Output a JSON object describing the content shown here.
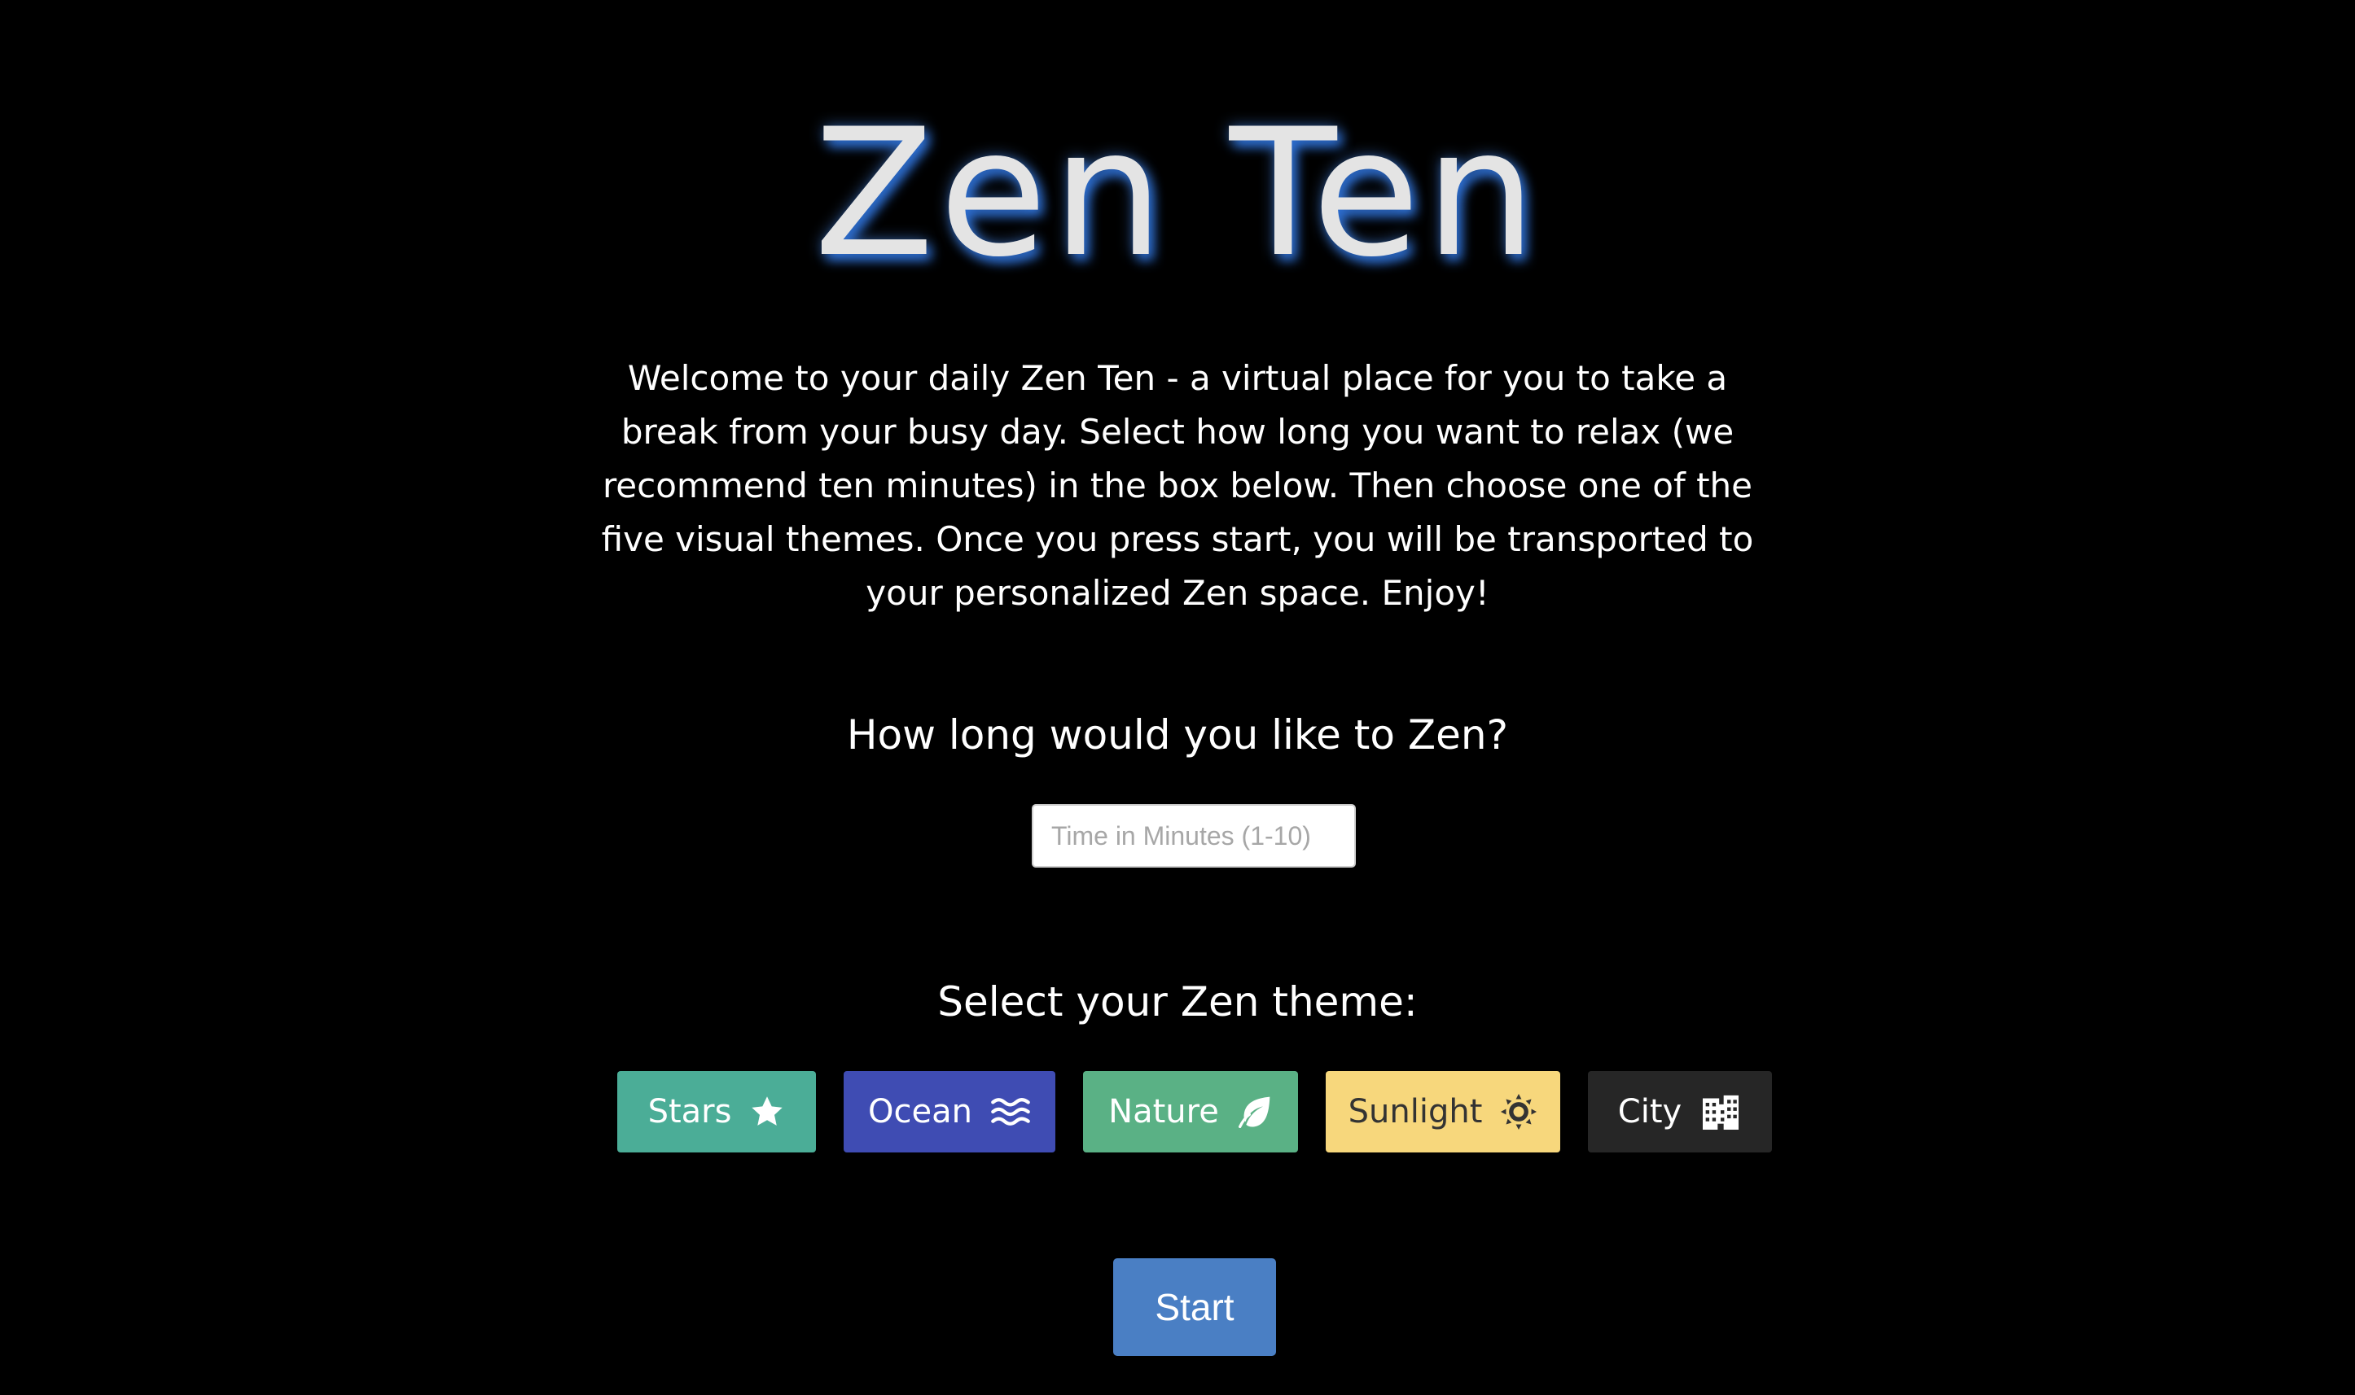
{
  "title": "Zen Ten",
  "intro": "Welcome to your daily Zen Ten - a virtual place for you to take a break from your busy day. Select how long you want to relax (we recommend ten minutes) in the box below. Then choose one of the five visual themes. Once you press start, you will be transported to your personalized Zen space. Enjoy!",
  "time_prompt": "How long would you like to Zen?",
  "time_input": {
    "value": "",
    "placeholder": "Time in Minutes (1-10)"
  },
  "theme_prompt": "Select your Zen theme:",
  "themes": [
    {
      "label": "Stars",
      "icon": "star-icon",
      "color": "#4bad97"
    },
    {
      "label": "Ocean",
      "icon": "water-icon",
      "color": "#3f4cb3"
    },
    {
      "label": "Nature",
      "icon": "leaf-icon",
      "color": "#5ab185"
    },
    {
      "label": "Sunlight",
      "icon": "sun-icon",
      "color": "#f7d77c"
    },
    {
      "label": "City",
      "icon": "city-icon",
      "color": "#262626"
    }
  ],
  "start_label": "Start",
  "colors": {
    "background": "#000000",
    "title_glow": "#2d6fd3",
    "start_button": "#4a7fc4"
  }
}
